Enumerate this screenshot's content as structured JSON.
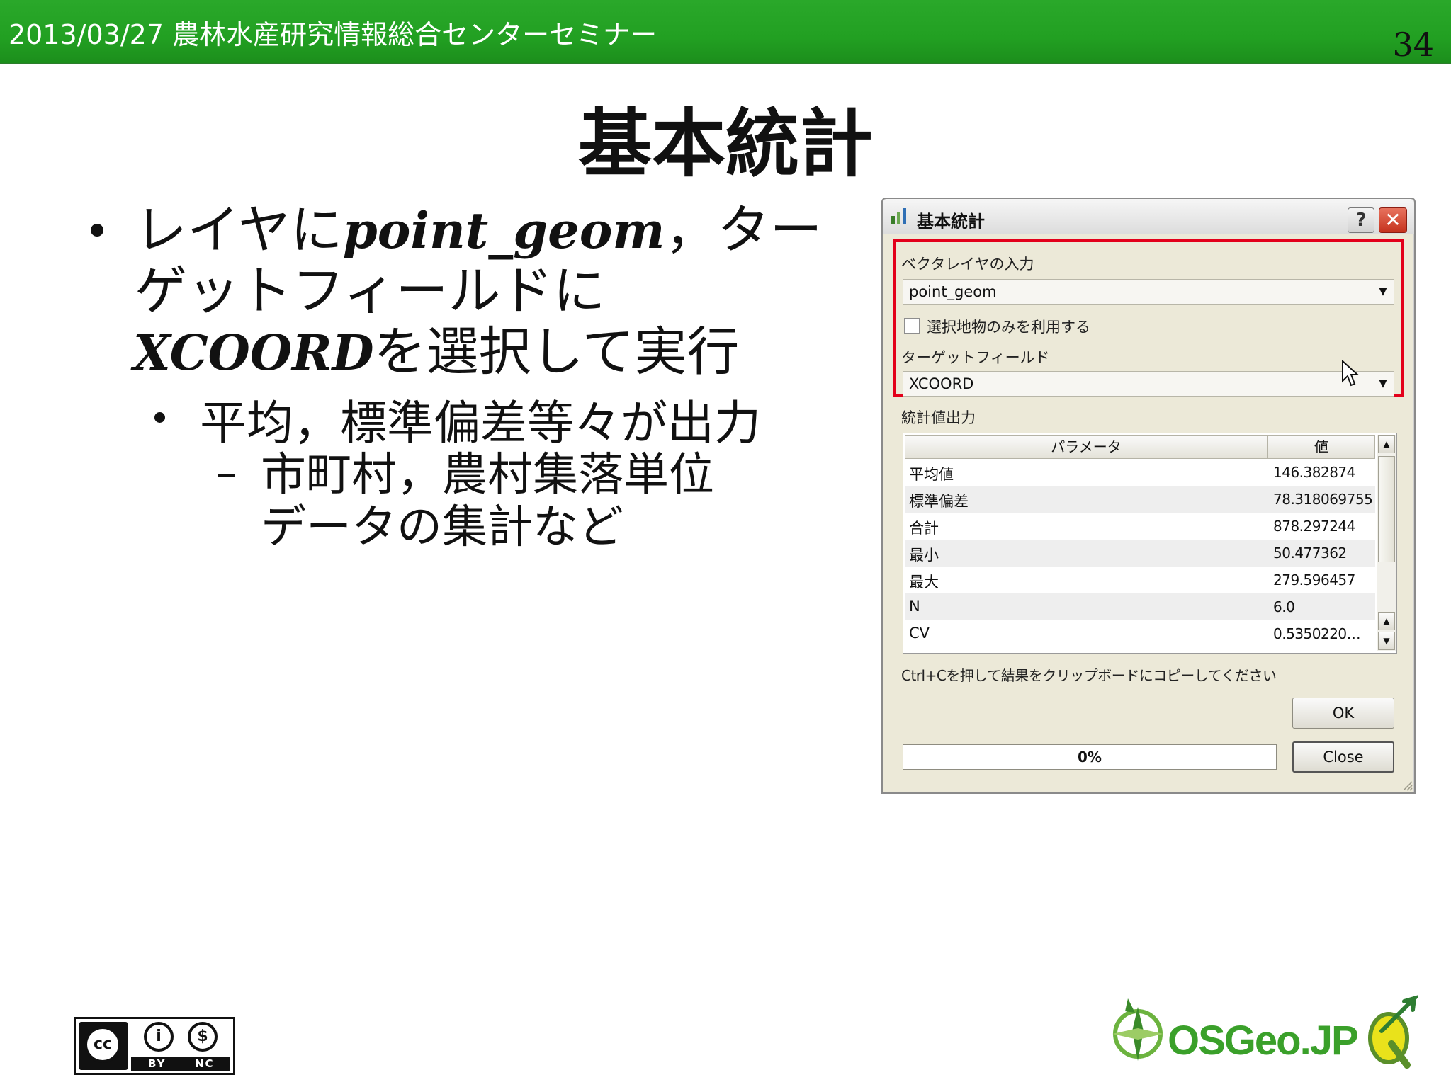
{
  "header": {
    "title": "2013/03/27 農林水産研究情報総合センターセミナー",
    "page_number": "34"
  },
  "slide": {
    "title": "基本統計",
    "bullet1": {
      "line1_pre": "レイヤに",
      "line1_code": "point_geom",
      "line1_post": "，ター",
      "line2": "ゲットフィールドに",
      "line3_code": "XCOORD",
      "line3_post": "を選択して実行"
    },
    "bullet2": "平均，標準偏差等々が出力",
    "bullet3": {
      "line1": "市町村，農村集落単位",
      "line2": "データの集計など"
    }
  },
  "dialog": {
    "title": "基本統計",
    "help_label": "?",
    "close_label": "✕",
    "vector_layer_label": "ベクタレイヤの入力",
    "vector_layer_value": "point_geom",
    "selected_only_label": "選択地物のみを利用する",
    "selected_only_checked": false,
    "target_field_label": "ターゲットフィールド",
    "target_field_value": "XCOORD",
    "stats_output_label": "統計値出力",
    "table": {
      "columns": [
        "パラメータ",
        "値"
      ],
      "rows": [
        {
          "param": "平均値",
          "value": "146.382874"
        },
        {
          "param": "標準偏差",
          "value": "78.318069755"
        },
        {
          "param": "合計",
          "value": "878.297244"
        },
        {
          "param": "最小",
          "value": "50.477362"
        },
        {
          "param": "最大",
          "value": "279.596457"
        },
        {
          "param": "N",
          "value": "6.0"
        },
        {
          "param": "CV",
          "value": "0.5350220…"
        }
      ]
    },
    "clipboard_hint": "Ctrl+Cを押して結果をクリップボードにコピーしてください",
    "ok_label": "OK",
    "progress_text": "0%",
    "progress_value": 0,
    "close_button_label": "Close"
  },
  "footer": {
    "cc_by": "BY",
    "cc_nc": "NC",
    "cc_mark": "cc",
    "osgeo_label": "OSGeo.JP"
  },
  "colors": {
    "header_green": "#22a022",
    "highlight_red": "#e3001b",
    "dialog_bg": "#ece9d8",
    "osgeo_green": "#3aa02a"
  }
}
